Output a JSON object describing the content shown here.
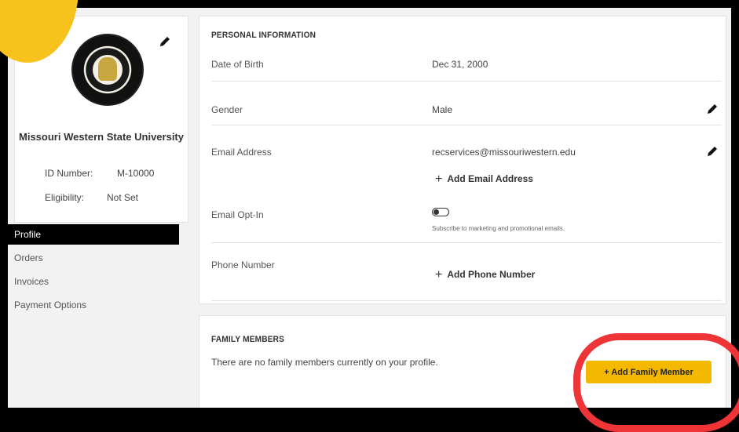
{
  "profile_card": {
    "org_name": "Missouri Western State University",
    "id_label": "ID Number:",
    "id_value": "M-10000",
    "eligibility_label": "Eligibility:",
    "eligibility_value": "Not Set"
  },
  "nav": {
    "items": [
      {
        "label": "Profile",
        "active": true
      },
      {
        "label": "Orders"
      },
      {
        "label": "Invoices"
      },
      {
        "label": "Payment Options"
      }
    ]
  },
  "personal": {
    "title": "PERSONAL INFORMATION",
    "dob_label": "Date of Birth",
    "dob_value": "Dec 31, 2000",
    "gender_label": "Gender",
    "gender_value": "Male",
    "email_label": "Email Address",
    "email_value": "recservices@missouriwestern.edu",
    "add_email": "Add Email Address",
    "optin_label": "Email Opt-In",
    "optin_hint": "Subscribe to marketing and promotional emails.",
    "optin_on": false,
    "phone_label": "Phone Number",
    "add_phone": "Add Phone Number"
  },
  "family": {
    "title": "FAMILY MEMBERS",
    "empty_text": "There are no family members currently on your profile.",
    "add_button": "+ Add Family Member"
  },
  "colors": {
    "accent_yellow": "#f5b800",
    "highlight_red": "#ee3437",
    "nav_active_bg": "#000000"
  },
  "icons": {
    "edit": "pencil-icon",
    "add": "plus-icon",
    "seal": "university-seal"
  }
}
